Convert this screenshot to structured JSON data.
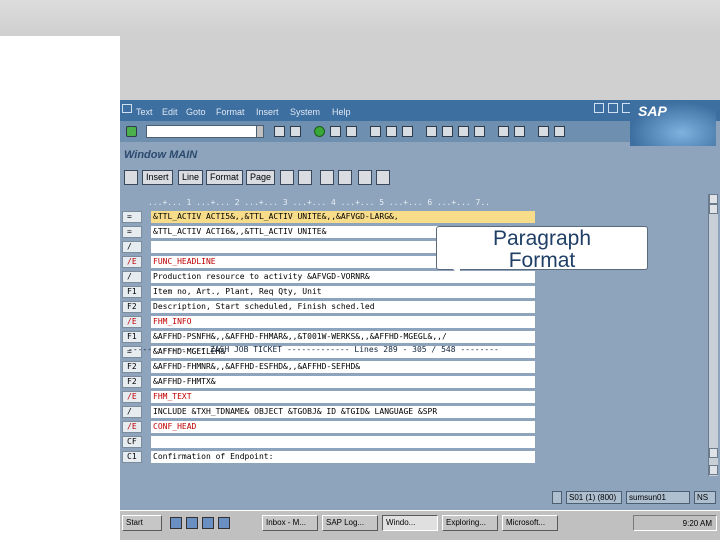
{
  "menu": [
    "Text",
    "Edit",
    "Goto",
    "Format",
    "Insert",
    "System",
    "Help"
  ],
  "logo": "SAP",
  "screen_title": "Window MAIN",
  "app_buttons": [
    "Insert",
    "Line",
    "Format",
    "Page"
  ],
  "ruler": "...+... 1 ...+... 2 ...+... 3 ...+... 4 ...+... 5 ...+... 6 ...+... 7..",
  "rows": [
    {
      "fmt": "=",
      "text": "&TTL_ACTIV ACTI5&,,&TTL_ACTIV UNITE&,,&AFVGD-LARG&,",
      "style": "hl"
    },
    {
      "fmt": "=",
      "text": "&TTL_ACTIV ACTI6&,,&TTL_ACTIV UNITE&",
      "style": ""
    },
    {
      "fmt": "/",
      "text": "",
      "style": ""
    },
    {
      "fmt": "/E",
      "text": "FUNC_HEADLINE",
      "style": "red"
    },
    {
      "fmt": "/",
      "text": "Production resource to activity &AFVGD-VORNR&",
      "style": ""
    },
    {
      "fmt": "F1",
      "text": "Item no, Art., Plant, Req Qty, Unit",
      "style": ""
    },
    {
      "fmt": "F2",
      "text": "Description, Start scheduled, Finish sched.led",
      "style": ""
    },
    {
      "fmt": "/E",
      "text": "FHM_INFO",
      "style": "red"
    },
    {
      "fmt": "F1",
      "text": "&AFFHD-PSNFH&,,&AFFHD-FHMAR&,,&T001W-WERKS&,,&AFFHD-MGEGL&,,/",
      "style": ""
    },
    {
      "fmt": "=",
      "text": "&AFFHD-MGEILEH&",
      "style": ""
    },
    {
      "fmt": "F2",
      "text": "&AFFHD-FHMNR&,,&AFFHD-ESFHD&,,&AFFHD-SEFHD&",
      "style": ""
    },
    {
      "fmt": "F2",
      "text": "&AFFHD-FHMTX&",
      "style": ""
    },
    {
      "fmt": "/E",
      "text": "FHM_TEXT",
      "style": "red"
    },
    {
      "fmt": "/",
      "text": "INCLUDE &TXH_TDNAME& OBJECT &TGOBJ& ID &TGID& LANGUAGE &SPR",
      "style": ""
    },
    {
      "fmt": "/E",
      "text": "CONF_HEAD",
      "style": "red"
    },
    {
      "fmt": "CF",
      "text": "",
      "style": ""
    },
    {
      "fmt": "C1",
      "text": "Confirmation of Endpoint:",
      "style": ""
    }
  ],
  "lines_info": "---------------- ZASH JOB TICKET ------------- Lines 289 - 305 / 548 --------",
  "status": {
    "session": "S01 (1) (800)",
    "server": "sumsun01",
    "mode": "NS"
  },
  "taskbar": {
    "start": "Start",
    "tasks": [
      "Inbox - M...",
      "SAP Log...",
      "Windo...",
      "Exploring...",
      "Microsoft..."
    ],
    "clock": "9:20 AM"
  },
  "callout": {
    "line1": "Paragraph",
    "line2": "Format"
  }
}
